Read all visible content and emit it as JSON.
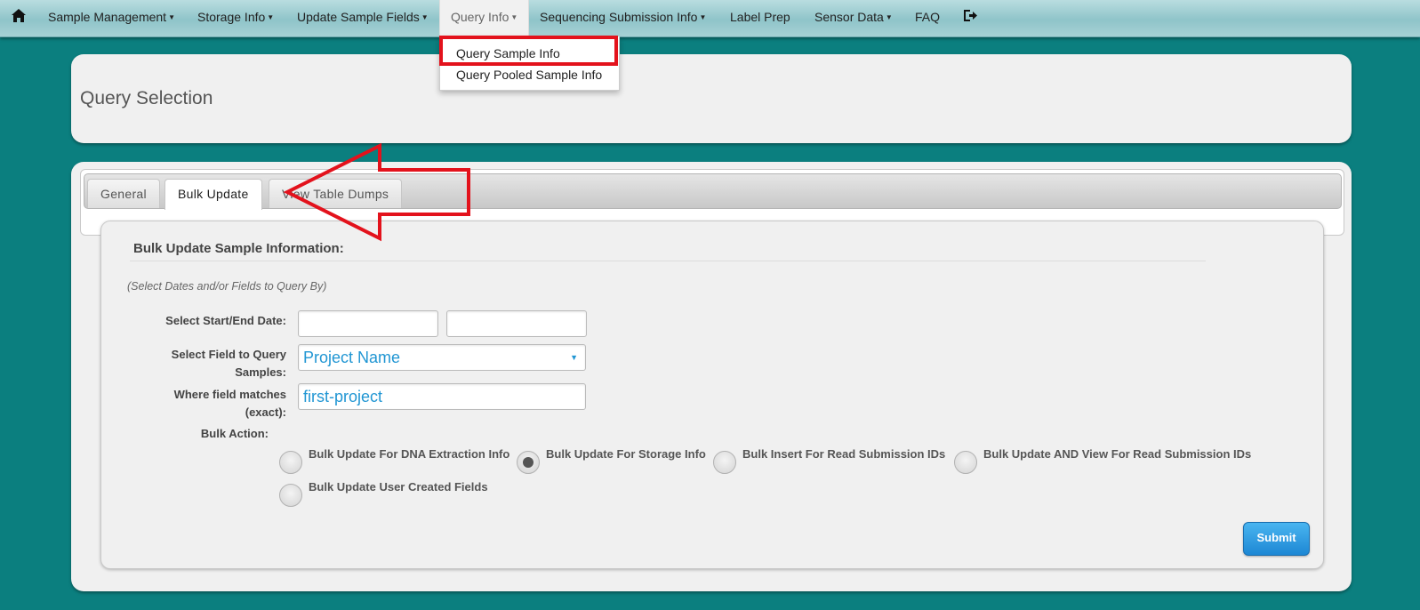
{
  "navbar": {
    "items": [
      {
        "label": "Sample Management",
        "dropdown": true
      },
      {
        "label": "Storage Info",
        "dropdown": true
      },
      {
        "label": "Update Sample Fields",
        "dropdown": true
      },
      {
        "label": "Query Info",
        "dropdown": true,
        "active": true
      },
      {
        "label": "Sequencing Submission Info",
        "dropdown": true
      },
      {
        "label": "Label Prep",
        "dropdown": false
      },
      {
        "label": "Sensor Data",
        "dropdown": true
      },
      {
        "label": "FAQ",
        "dropdown": false
      }
    ],
    "home_icon": "home-icon",
    "logout_icon": "logout-icon",
    "dropdown_items": [
      "Query Sample Info",
      "Query Pooled Sample Info"
    ]
  },
  "header_panel": {
    "title": "Query Selection"
  },
  "tabs": [
    "General",
    "Bulk Update",
    "View Table Dumps"
  ],
  "active_tab": "Bulk Update",
  "form": {
    "title": "Bulk Update Sample Information:",
    "hint": "(Select Dates and/or Fields to Query By)",
    "date_label": "Select Start/End Date:",
    "start_date": "",
    "end_date": "",
    "field_label_1": "Select Field to Query",
    "field_label_2": "Samples:",
    "field_value": "Project Name",
    "match_label_1": "Where field matches",
    "match_label_2": "(exact):",
    "match_value": "first-project",
    "bulk_action_label": "Bulk Action:",
    "actions": [
      {
        "label": "Bulk Update For DNA Extraction Info",
        "selected": false
      },
      {
        "label": "Bulk Update For Storage Info",
        "selected": true
      },
      {
        "label": "Bulk Insert For Read Submission IDs",
        "selected": false
      },
      {
        "label": "Bulk Update AND View For Read Submission IDs",
        "selected": false
      },
      {
        "label": "Bulk Update User Created Fields",
        "selected": false
      }
    ],
    "submit_label": "Submit"
  },
  "colors": {
    "background": "#0b7f7f",
    "highlight": "#e3121c",
    "link": "#2196d3",
    "submit": "#1d87d4"
  }
}
